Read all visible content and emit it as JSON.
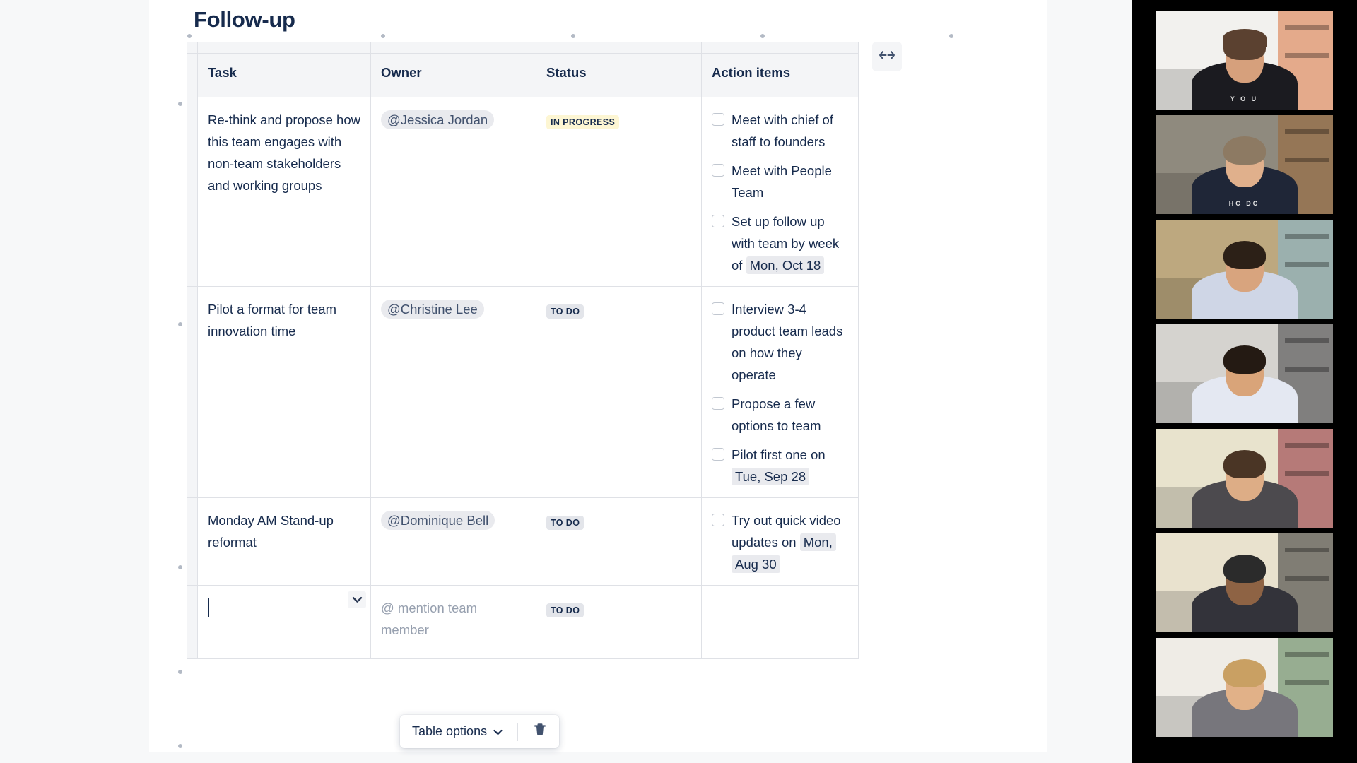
{
  "document": {
    "title": "Follow-up"
  },
  "table": {
    "columns": [
      "Task",
      "Owner",
      "Status",
      "Action items"
    ],
    "rows": [
      {
        "task": "Re-think and propose how this team engages with non-team stakeholders and working groups",
        "owner": "@Jessica Jordan",
        "status": "IN PROGRESS",
        "status_type": "in-progress",
        "action_items": [
          {
            "checked": false,
            "text": "Meet with chief of staff to founders",
            "date": ""
          },
          {
            "checked": false,
            "text": "Meet with People Team",
            "date": ""
          },
          {
            "checked": false,
            "text": "Set up follow up with team by week of ",
            "date": "Mon, Oct 18"
          }
        ]
      },
      {
        "task": "Pilot a format for team innovation time",
        "owner": "@Christine Lee",
        "status": "TO DO",
        "status_type": "to-do",
        "action_items": [
          {
            "checked": false,
            "text": "Interview 3-4 product team leads on how they operate",
            "date": ""
          },
          {
            "checked": false,
            "text": "Propose a few options to team",
            "date": ""
          },
          {
            "checked": false,
            "text": "Pilot first one on ",
            "date": "Tue, Sep 28"
          }
        ]
      },
      {
        "task": "Monday AM Stand-up reformat",
        "owner": "@Dominique Bell",
        "status": "TO DO",
        "status_type": "to-do",
        "action_items": [
          {
            "checked": false,
            "text": "Try out quick video updates on ",
            "date": "Mon, Aug 30"
          }
        ]
      }
    ],
    "new_row": {
      "task_value": "",
      "owner_placeholder": "@ mention team member",
      "status": "TO DO",
      "status_type": "to-do",
      "action_items": []
    }
  },
  "toolbar": {
    "table_options_label": "Table options",
    "chevron_icon": "chevron-down-icon",
    "delete_icon": "trash-icon"
  },
  "controls": {
    "resize_icon": "left-right-arrow-icon",
    "cell_chevron_icon": "chevron-down-icon"
  },
  "colors": {
    "page_background": "#f7f8f9",
    "canvas": "#ffffff",
    "text": "#172b4d",
    "muted_text": "#97a0af",
    "border": "#dfe1e6",
    "header_fill": "#f4f5f7",
    "chip_fill": "#e9eaee",
    "lozenge_inprogress": "#fdf6d3",
    "lozenge_todo": "#e3e5ea",
    "video_rail": "#000000",
    "handle_dot": "#b3bac5"
  },
  "video_rail": {
    "participants": [
      {
        "id": "participant-1",
        "shirt": "#1b1b20",
        "skin": "#d6a07c",
        "hair": "#5b4130",
        "wall": "#f2f1ee",
        "accent": "#d8703a",
        "tee_text": "Y O U",
        "has_cap": true
      },
      {
        "id": "participant-2",
        "shirt": "#1f2637",
        "skin": "#e0b08c",
        "hair": "#8d7a63",
        "wall": "#8f8a7e",
        "accent": "#9a6634",
        "tee_text": "HC DC",
        "has_cap": false
      },
      {
        "id": "participant-3",
        "shirt": "#cfd6e6",
        "skin": "#d8a47e",
        "hair": "#2c2017",
        "wall": "#bda87f",
        "accent": "#7fb6d6",
        "tee_text": "",
        "has_cap": false
      },
      {
        "id": "participant-4",
        "shirt": "#e4e8f2",
        "skin": "#d9a479",
        "hair": "#241a13",
        "wall": "#d5d3cf",
        "accent": "#3a3a3c",
        "tee_text": "",
        "has_cap": false
      },
      {
        "id": "participant-5",
        "shirt": "#4c4a4e",
        "skin": "#ddad86",
        "hair": "#4a3525",
        "wall": "#e8e3cd",
        "accent": "#8c2533",
        "tee_text": "",
        "has_cap": false
      },
      {
        "id": "participant-6",
        "shirt": "#33333a",
        "skin": "#8e6344",
        "hair": "#2b2b2b",
        "wall": "#e9e2ce",
        "accent": "#2a2a2a",
        "tee_text": "",
        "has_cap": false
      },
      {
        "id": "participant-7",
        "shirt": "#77767c",
        "skin": "#e1b188",
        "hair": "#c9a063",
        "wall": "#efece6",
        "accent": "#4e7a4a",
        "tee_text": "",
        "has_cap": false
      }
    ]
  }
}
